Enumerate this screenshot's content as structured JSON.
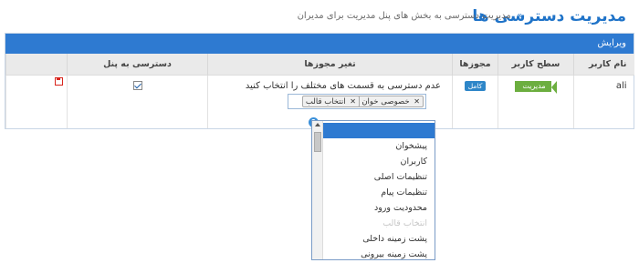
{
  "header": {
    "title": "مدیریت دسترسی ها",
    "separator": "»",
    "subtitle": "مدیریت دسترسی به بخش های پنل مدیریت برای مدیران"
  },
  "panel": {
    "heading": "ویرایش"
  },
  "table": {
    "columns": {
      "user": "نام کاربر",
      "level": "سطح کاربر",
      "permissions": "مجوزها",
      "change": "تغیر مجوزها",
      "panel_access": "دسترسی به پنل"
    },
    "row": {
      "user": "ali",
      "level": "مدیریت",
      "permissions": "کامل",
      "change_text": "عدم دسترسی به قسمت های مختلف را انتخاب کنید",
      "chips": [
        "خصوصی خوان",
        "انتخاب قالب"
      ],
      "chip_remove": "✕",
      "help": "?",
      "panel_access_checked": true
    }
  },
  "dropdown": {
    "items": [
      {
        "label": "",
        "state": "highlight"
      },
      {
        "label": "پیشخوان",
        "state": "normal"
      },
      {
        "label": "کاربران",
        "state": "normal"
      },
      {
        "label": "تنظیمات اصلی",
        "state": "normal"
      },
      {
        "label": "تنظیمات پیام",
        "state": "normal"
      },
      {
        "label": "محدودیت ورود",
        "state": "normal"
      },
      {
        "label": "انتخاب قالب",
        "state": "disabled"
      },
      {
        "label": "پشت زمینه داخلی",
        "state": "normal"
      },
      {
        "label": "پشت زمینه بیرونی",
        "state": "normal"
      }
    ]
  },
  "colors": {
    "accent": "#2e7ad1",
    "title": "#1f73c8",
    "level_tag": "#6cae3f",
    "save_icon": "#d9251d"
  }
}
